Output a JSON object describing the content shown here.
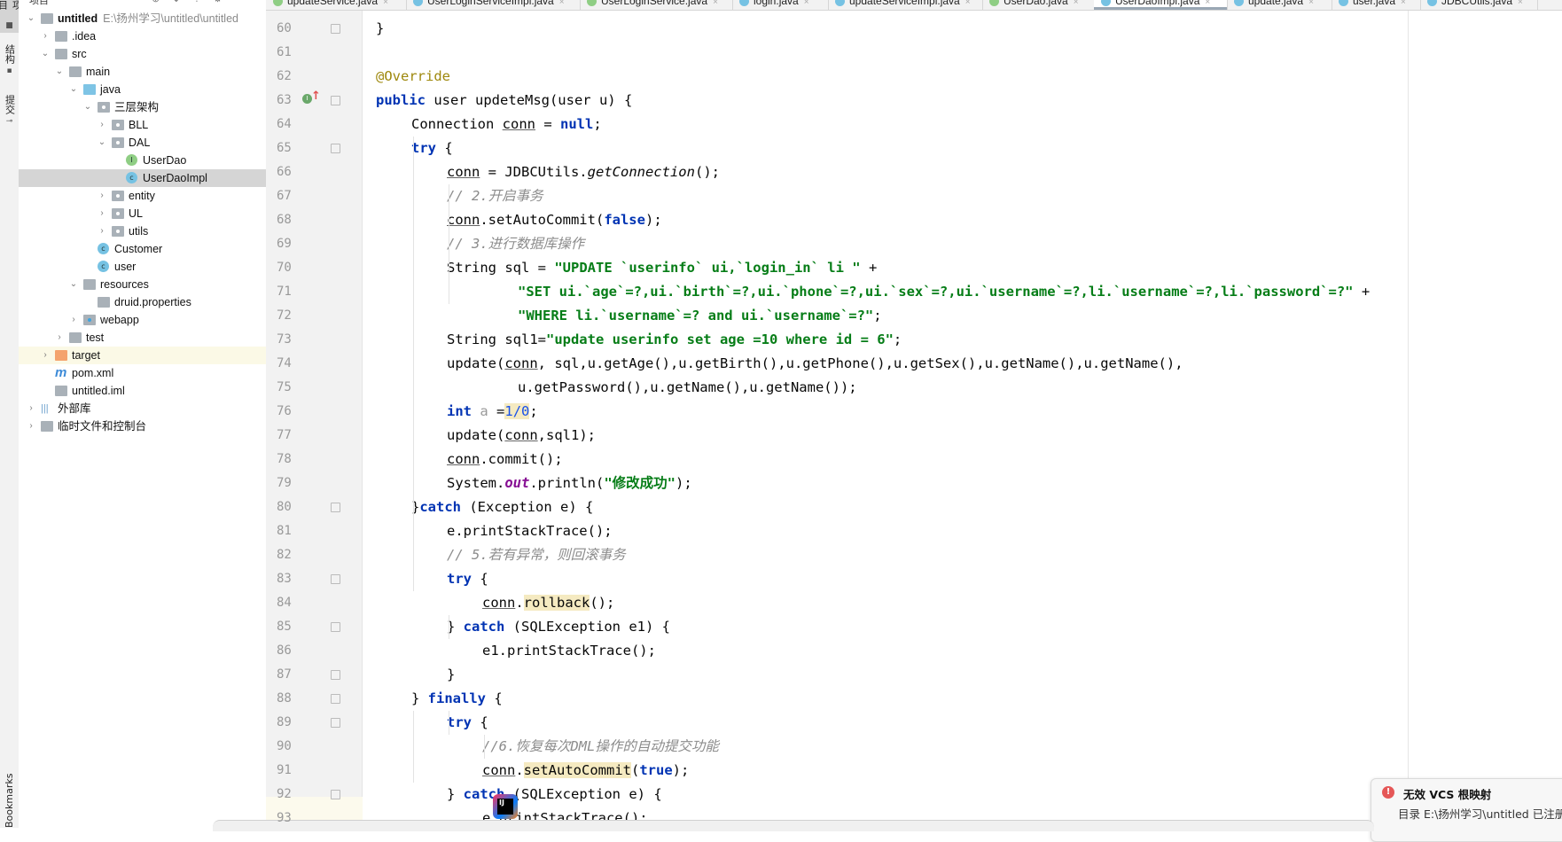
{
  "toolstrip": {
    "tabs": [
      {
        "label": "项目",
        "icon": "folder-icon",
        "active": true
      },
      {
        "label": "结构",
        "icon": "structure-icon",
        "active": false
      },
      {
        "label": "提交",
        "icon": "commit-icon",
        "active": false
      }
    ],
    "bottom_tab": "Bookmarks"
  },
  "project": {
    "toolbar_title": "项目",
    "tree": [
      {
        "label": "untitled",
        "path": "E:\\扬州学习\\untitled\\untitled",
        "depth": 0,
        "expanded": true,
        "icon": "module-folder",
        "bold": true
      },
      {
        "label": ".idea",
        "depth": 1,
        "expanded": false,
        "icon": "folder"
      },
      {
        "label": "src",
        "depth": 1,
        "expanded": true,
        "icon": "folder"
      },
      {
        "label": "main",
        "depth": 2,
        "expanded": true,
        "icon": "folder"
      },
      {
        "label": "java",
        "depth": 3,
        "expanded": true,
        "icon": "source-folder"
      },
      {
        "label": "三层架构",
        "depth": 4,
        "expanded": true,
        "icon": "package"
      },
      {
        "label": "BLL",
        "depth": 5,
        "expanded": false,
        "icon": "package"
      },
      {
        "label": "DAL",
        "depth": 5,
        "expanded": true,
        "icon": "package"
      },
      {
        "label": "UserDao",
        "depth": 6,
        "icon": "interface"
      },
      {
        "label": "UserDaoImpl",
        "depth": 6,
        "icon": "class",
        "selected": true
      },
      {
        "label": "entity",
        "depth": 5,
        "expanded": false,
        "icon": "package"
      },
      {
        "label": "UL",
        "depth": 5,
        "expanded": false,
        "icon": "package"
      },
      {
        "label": "utils",
        "depth": 5,
        "expanded": false,
        "icon": "package"
      },
      {
        "label": "Customer",
        "depth": 4,
        "icon": "class"
      },
      {
        "label": "user",
        "depth": 4,
        "icon": "class"
      },
      {
        "label": "resources",
        "depth": 3,
        "expanded": true,
        "icon": "resources-folder"
      },
      {
        "label": "druid.properties",
        "depth": 4,
        "icon": "properties-file"
      },
      {
        "label": "webapp",
        "depth": 3,
        "expanded": false,
        "icon": "web-folder"
      },
      {
        "label": "test",
        "depth": 2,
        "expanded": false,
        "icon": "folder"
      },
      {
        "label": "target",
        "depth": 1,
        "expanded": false,
        "icon": "excluded-folder",
        "excluded": true
      },
      {
        "label": "pom.xml",
        "depth": 1,
        "icon": "maven-file"
      },
      {
        "label": "untitled.iml",
        "depth": 1,
        "icon": "iml-file"
      },
      {
        "label": "外部库",
        "depth": 0,
        "expanded": false,
        "icon": "library"
      },
      {
        "label": "临时文件和控制台",
        "depth": 0,
        "expanded": false,
        "icon": "scratches"
      }
    ]
  },
  "tabs": [
    {
      "label": "updateService.java",
      "kind": "interface"
    },
    {
      "label": "UserLoginServiceImpl.java",
      "kind": "class"
    },
    {
      "label": "UserLoginService.java",
      "kind": "interface"
    },
    {
      "label": "login.java",
      "kind": "class"
    },
    {
      "label": "updateServiceImpl.java",
      "kind": "class"
    },
    {
      "label": "UserDao.java",
      "kind": "interface"
    },
    {
      "label": "UserDaoImpl.java",
      "kind": "class",
      "active": true
    },
    {
      "label": "update.java",
      "kind": "class"
    },
    {
      "label": "user.java",
      "kind": "class"
    },
    {
      "label": "JDBCUtils.java",
      "kind": "class"
    }
  ],
  "editor": {
    "first_line": 60,
    "gutter_markers": {
      "63": "implements-method-icon"
    },
    "fold_lines": [
      60,
      63,
      65,
      80,
      83,
      85,
      87,
      88,
      89,
      92
    ],
    "lines": [
      [
        [
          0,
          "}",
          ""
        ]
      ],
      [],
      [
        [
          0,
          "@Override",
          "ann"
        ]
      ],
      [
        [
          0,
          "public",
          "kw"
        ],
        [
          0,
          " user updeteMsg(user u) {",
          ""
        ]
      ],
      [
        [
          1,
          "Connection ",
          ""
        ],
        [
          1,
          "conn",
          "ul"
        ],
        [
          1,
          " = ",
          ""
        ],
        [
          1,
          "null",
          "kw"
        ],
        [
          1,
          ";",
          ""
        ]
      ],
      [
        [
          1,
          "try",
          "kw"
        ],
        [
          1,
          " {",
          ""
        ]
      ],
      [
        [
          2,
          "conn",
          "ul"
        ],
        [
          2,
          " = JDBCUtils.",
          ""
        ],
        [
          2,
          "getConnection",
          "it"
        ],
        [
          2,
          "();",
          ""
        ]
      ],
      [
        [
          2,
          "// 2.开启事务",
          "cmt"
        ]
      ],
      [
        [
          2,
          "conn",
          "ul"
        ],
        [
          2,
          ".setAutoCommit(",
          ""
        ],
        [
          2,
          "false",
          "kw"
        ],
        [
          2,
          ");",
          ""
        ]
      ],
      [
        [
          2,
          "// 3.进行数据库操作",
          "cmt"
        ]
      ],
      [
        [
          2,
          "String sql = ",
          ""
        ],
        [
          2,
          "\"UPDATE `userinfo` ui,`login_in` li \"",
          "str"
        ],
        [
          2,
          " +",
          ""
        ]
      ],
      [
        [
          4,
          "\"SET ui.`age`=?,ui.`birth`=?,ui.`phone`=?,ui.`sex`=?,ui.`username`=?,li.`username`=?,li.`password`=?\"",
          "str"
        ],
        [
          4,
          " +",
          ""
        ]
      ],
      [
        [
          4,
          "\"WHERE li.`username`=? and ui.`username`=?\"",
          "str"
        ],
        [
          4,
          ";",
          ""
        ]
      ],
      [
        [
          2,
          "String sql1=",
          ""
        ],
        [
          2,
          "\"update userinfo set age =10 where id = 6\"",
          "str"
        ],
        [
          2,
          ";",
          ""
        ]
      ],
      [
        [
          2,
          "update(",
          ""
        ],
        [
          2,
          "conn",
          "ul"
        ],
        [
          2,
          ", sql,u.getAge(),u.getBirth(),u.getPhone(),u.getSex(),u.getName(),u.getName(),",
          ""
        ]
      ],
      [
        [
          4,
          "u.getPassword(),u.getName(),u.getName());",
          ""
        ]
      ],
      [
        [
          2,
          "int",
          "kw"
        ],
        [
          2,
          " ",
          ""
        ],
        [
          2,
          "a",
          "faded"
        ],
        [
          2,
          " =",
          ""
        ],
        [
          2,
          "1/0",
          "num hl"
        ],
        [
          2,
          ";",
          ""
        ]
      ],
      [
        [
          2,
          "update(",
          ""
        ],
        [
          2,
          "conn",
          "ul"
        ],
        [
          2,
          ",sql1);",
          ""
        ]
      ],
      [
        [
          2,
          "conn",
          "ul"
        ],
        [
          2,
          ".commit();",
          ""
        ]
      ],
      [
        [
          2,
          "System.",
          ""
        ],
        [
          2,
          "out",
          "stat"
        ],
        [
          2,
          ".println(",
          ""
        ],
        [
          2,
          "\"修改成功\"",
          "str"
        ],
        [
          2,
          ");",
          ""
        ]
      ],
      [
        [
          1,
          "}",
          ""
        ],
        [
          1,
          "catch",
          "kw"
        ],
        [
          1,
          " (Exception e) {",
          ""
        ]
      ],
      [
        [
          2,
          "e.printStackTrace();",
          ""
        ]
      ],
      [
        [
          2,
          "// 5.若有异常，则回滚事务",
          "cmt"
        ]
      ],
      [
        [
          2,
          "try",
          "kw"
        ],
        [
          2,
          " {",
          ""
        ]
      ],
      [
        [
          3,
          "conn",
          "ul"
        ],
        [
          3,
          ".",
          ""
        ],
        [
          3,
          "rollback",
          "hl"
        ],
        [
          3,
          "();",
          ""
        ]
      ],
      [
        [
          2,
          "} ",
          ""
        ],
        [
          2,
          "catch",
          "kw"
        ],
        [
          2,
          " (SQLException e1) {",
          ""
        ]
      ],
      [
        [
          3,
          "e1.printStackTrace();",
          ""
        ]
      ],
      [
        [
          2,
          "}",
          ""
        ]
      ],
      [
        [
          1,
          "} ",
          ""
        ],
        [
          1,
          "finally",
          "kw"
        ],
        [
          1,
          " {",
          ""
        ]
      ],
      [
        [
          2,
          "try",
          "kw"
        ],
        [
          2,
          " {",
          ""
        ]
      ],
      [
        [
          3,
          "//6.恢复每次DML操作的自动提交功能",
          "cmt"
        ]
      ],
      [
        [
          3,
          "conn",
          "ul"
        ],
        [
          3,
          ".",
          ""
        ],
        [
          3,
          "setAutoCommit",
          "hl"
        ],
        [
          3,
          "(",
          ""
        ],
        [
          3,
          "true",
          "kw"
        ],
        [
          3,
          ");",
          ""
        ]
      ],
      [
        [
          2,
          "} ",
          ""
        ],
        [
          2,
          "catch",
          "kw"
        ],
        [
          2,
          " (SQLException e) {",
          ""
        ]
      ],
      [
        [
          3,
          "e.printStackTrace();",
          ""
        ]
      ]
    ]
  },
  "notification": {
    "title": "无效 VCS 根映射",
    "body": "目录 E:\\扬州学习\\untitled 已注册"
  },
  "colors": {
    "keyword": "#0033b3",
    "string": "#067d17",
    "comment": "#8c8c8c",
    "annotation": "#9e880d",
    "number": "#1750eb",
    "selection": "#d5d5d5",
    "highlight": "#f5eac1",
    "error": "#e55757"
  }
}
